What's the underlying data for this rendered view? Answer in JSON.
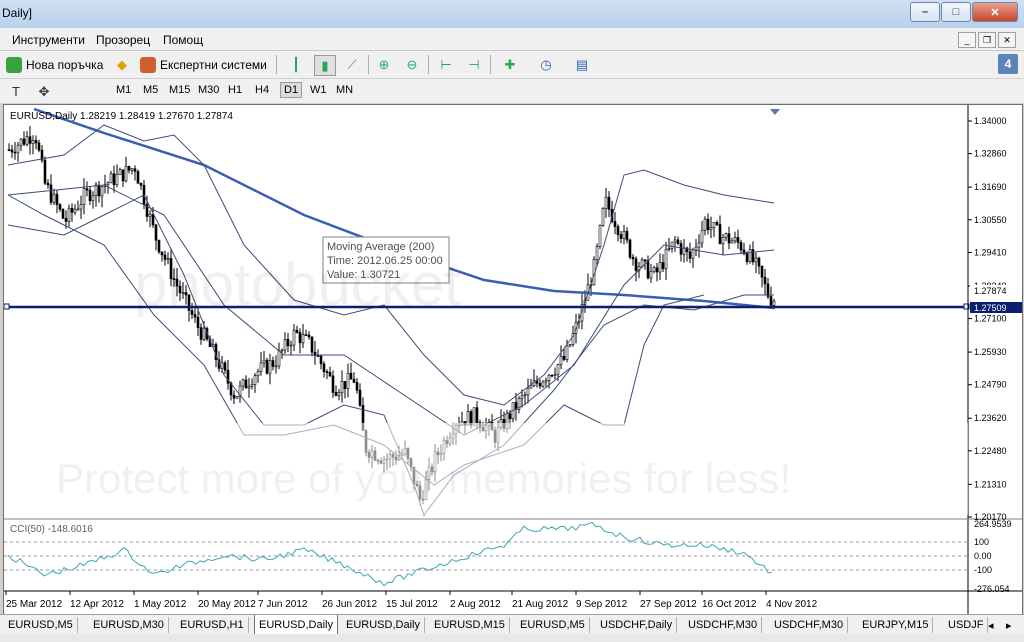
{
  "window": {
    "title": "Daily]"
  },
  "menu": [
    "Инструменти",
    "Прозорец",
    "Помощ"
  ],
  "toolbar": {
    "new_order": "Нова поръчка",
    "expert_systems": "Експертни системи",
    "badge": "4"
  },
  "timeframes": [
    "M1",
    "M5",
    "M15",
    "M30",
    "H1",
    "H4",
    "D1",
    "W1",
    "MN"
  ],
  "active_timeframe": "D1",
  "chart": {
    "header": "EURUSD,Daily  1.28219 1.28419 1.27670 1.27874",
    "tooltip": {
      "line1": "Moving Average (200)",
      "line2": "Time: 2012.06.25 00:00",
      "line3": "Value: 1.30721"
    },
    "price_labels": [
      "1.34000",
      "1.32860",
      "1.31690",
      "1.30550",
      "1.29410",
      "1.28240",
      "1.27100",
      "1.25930",
      "1.24790",
      "1.23620",
      "1.22480",
      "1.21310",
      "1.20170"
    ],
    "current_price": "1.27874",
    "hline_price": "1.27509",
    "cci_label": "CCI(50) -148.6016",
    "cci_scale": [
      "264.9539",
      "100",
      "0.00",
      "-100",
      "-276.054"
    ],
    "date_labels": [
      "25 Mar 2012",
      "12 Apr 2012",
      "1 May 2012",
      "20 May 2012",
      "7 Jun 2012",
      "26 Jun 2012",
      "15 Jul 2012",
      "2 Aug 2012",
      "21 Aug 2012",
      "9 Sep 2012",
      "27 Sep 2012",
      "16 Oct 2012",
      "4 Nov 2012"
    ],
    "watermark_top": "photobucket",
    "watermark_bottom": "Protect more of your memories for less!"
  },
  "colors": {
    "ma": "#3a5fb0",
    "bands": "#3c4c78",
    "hline": "#0a1f6e",
    "cci": "#3aa8b0"
  },
  "tabs": [
    "EURUSD,M5",
    "EURUSD,M30",
    "EURUSD,H1",
    "EURUSD,Daily",
    "EURUSD,Daily",
    "EURUSD,M15",
    "EURUSD,M5",
    "USDCHF,Daily",
    "USDCHF,M30",
    "USDCHF,M30",
    "EURJPY,M15",
    "USDJF"
  ],
  "active_tab": 3
}
